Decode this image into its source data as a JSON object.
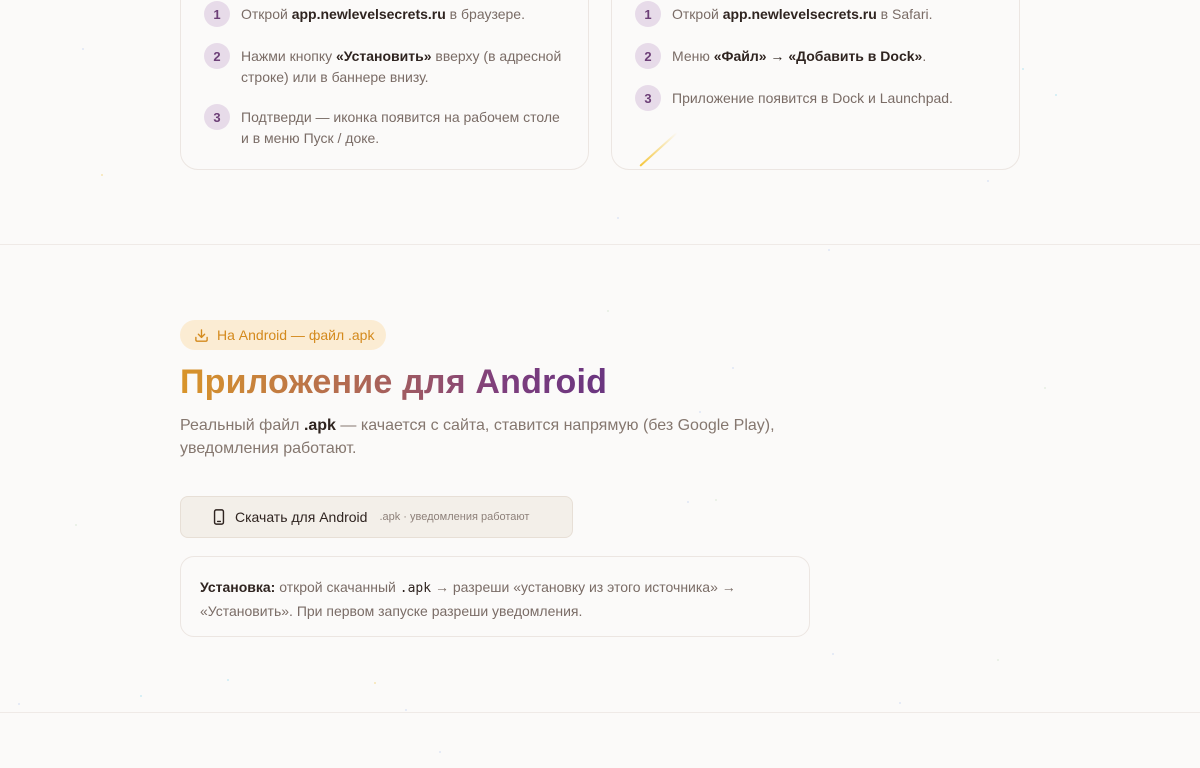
{
  "ios_card": {
    "steps": [
      {
        "num": "1",
        "pre": "Открой ",
        "bold": "app.newlevelsecrets.ru",
        "post": " в браузере."
      },
      {
        "num": "2",
        "pre": "Нажми кнопку ",
        "bold": "«Установить»",
        "post": " вверху (в адресной строке) или в баннере внизу."
      },
      {
        "num": "3",
        "pre": "Подтверди — иконка появится на рабочем столе и в меню Пуск / доке.",
        "bold": "",
        "post": ""
      }
    ]
  },
  "mac_card": {
    "steps": [
      {
        "num": "1",
        "pre": "Открой ",
        "bold": "app.newlevelsecrets.ru",
        "post": " в Safari."
      },
      {
        "num": "2",
        "pre": "Меню ",
        "bold": "«Файл» → «Добавить в Dock»",
        "post": "."
      },
      {
        "num": "3",
        "pre": "Приложение появится в Dock и Launchpad.",
        "bold": "",
        "post": ""
      }
    ]
  },
  "android": {
    "badge": "На Android — файл .apk",
    "title": "Приложение для Android",
    "lead_pre": "Реальный файл ",
    "lead_bold": ".apk",
    "lead_post": " — качается с сайта, ставится напрямую (без Google Play), уведомления работают.",
    "download_label": "Скачать для Android",
    "download_sub": ".apk · уведомления работают",
    "note_label": "Установка:",
    "note_pre": " открой скачанный ",
    "note_code": ".apk",
    "note_post": " → разреши «установку из этого источника» → «Установить». При первом запуске разреши уведомления."
  },
  "colors": {
    "accent_gold": "#d9952a",
    "accent_purple": "#6a3580",
    "badge_bg": "#fbecd3",
    "step_bg": "#e7dbe9"
  },
  "icons": {
    "badge": "download-icon",
    "download_button": "phone-icon"
  }
}
